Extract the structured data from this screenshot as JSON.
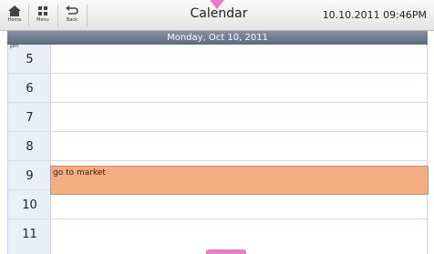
{
  "nav": {
    "home_label": "Home",
    "menu_label": "Menu",
    "back_label": "Back"
  },
  "app_title": "Calendar",
  "datetime": "10.10.2011 09:46PM",
  "day_header": "Monday, Oct 10, 2011",
  "ampm_label": "pm",
  "hours": [
    "5",
    "6",
    "7",
    "8",
    "9",
    "10",
    "11"
  ],
  "event": {
    "title": "go to market"
  },
  "colors": {
    "event_fill": "#f3ad82",
    "accent_pink": "#e97cc2",
    "header_bar": "#6d7a8d"
  }
}
